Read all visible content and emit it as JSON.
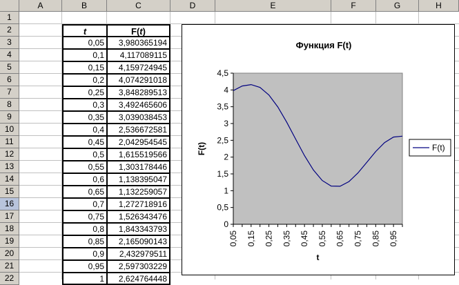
{
  "columns": [
    "A",
    "B",
    "C",
    "D",
    "E",
    "F",
    "G",
    "H"
  ],
  "rows": [
    "1",
    "2",
    "3",
    "4",
    "5",
    "6",
    "7",
    "8",
    "9",
    "10",
    "11",
    "12",
    "13",
    "14",
    "15",
    "16",
    "17",
    "18",
    "19",
    "20",
    "21",
    "22"
  ],
  "selected_row": "16",
  "table": {
    "header_t": "t",
    "header_F_prefix": "F(",
    "header_F_var": "t",
    "header_F_suffix": ")",
    "t": [
      "0,05",
      "0,1",
      "0,15",
      "0,2",
      "0,25",
      "0,3",
      "0,35",
      "0,4",
      "0,45",
      "0,5",
      "0,55",
      "0,6",
      "0,65",
      "0,7",
      "0,75",
      "0,8",
      "0,85",
      "0,9",
      "0,95",
      "1"
    ],
    "F": [
      "3,980365194",
      "4,117089115",
      "4,159724945",
      "4,074291018",
      "3,848289513",
      "3,492465606",
      "3,039038453",
      "2,536672581",
      "2,042954545",
      "1,615519566",
      "1,303178446",
      "1,138395047",
      "1,132259057",
      "1,272718916",
      "1,526343476",
      "1,843343793",
      "2,165090143",
      "2,432979511",
      "2,597303229",
      "2,624764448"
    ]
  },
  "chart_data": {
    "type": "line",
    "title": "Функция F(t)",
    "xlabel": "t",
    "ylabel": "F(t)",
    "ylim": [
      0,
      4.5
    ],
    "y_ticks": [
      "0",
      "0,5",
      "1",
      "1,5",
      "2",
      "2,5",
      "3",
      "3,5",
      "4",
      "4,5"
    ],
    "x_ticks": [
      "0,05",
      "0,15",
      "0,25",
      "0,35",
      "0,45",
      "0,55",
      "0,65",
      "0,75",
      "0,85",
      "0,95"
    ],
    "x": [
      0.05,
      0.1,
      0.15,
      0.2,
      0.25,
      0.3,
      0.35,
      0.4,
      0.45,
      0.5,
      0.55,
      0.6,
      0.65,
      0.7,
      0.75,
      0.8,
      0.85,
      0.9,
      0.95,
      1.0
    ],
    "series": [
      {
        "name": "F(t)",
        "color": "#000080",
        "values": [
          3.980365194,
          4.117089115,
          4.159724945,
          4.074291018,
          3.848289513,
          3.492465606,
          3.039038453,
          2.536672581,
          2.042954545,
          1.615519566,
          1.303178446,
          1.138395047,
          1.132259057,
          1.272718916,
          1.526343476,
          1.843343793,
          2.165090143,
          2.432979511,
          2.597303229,
          2.624764448
        ]
      }
    ],
    "plot_background": "#c0c0c0",
    "grid": false,
    "legend": "right"
  }
}
